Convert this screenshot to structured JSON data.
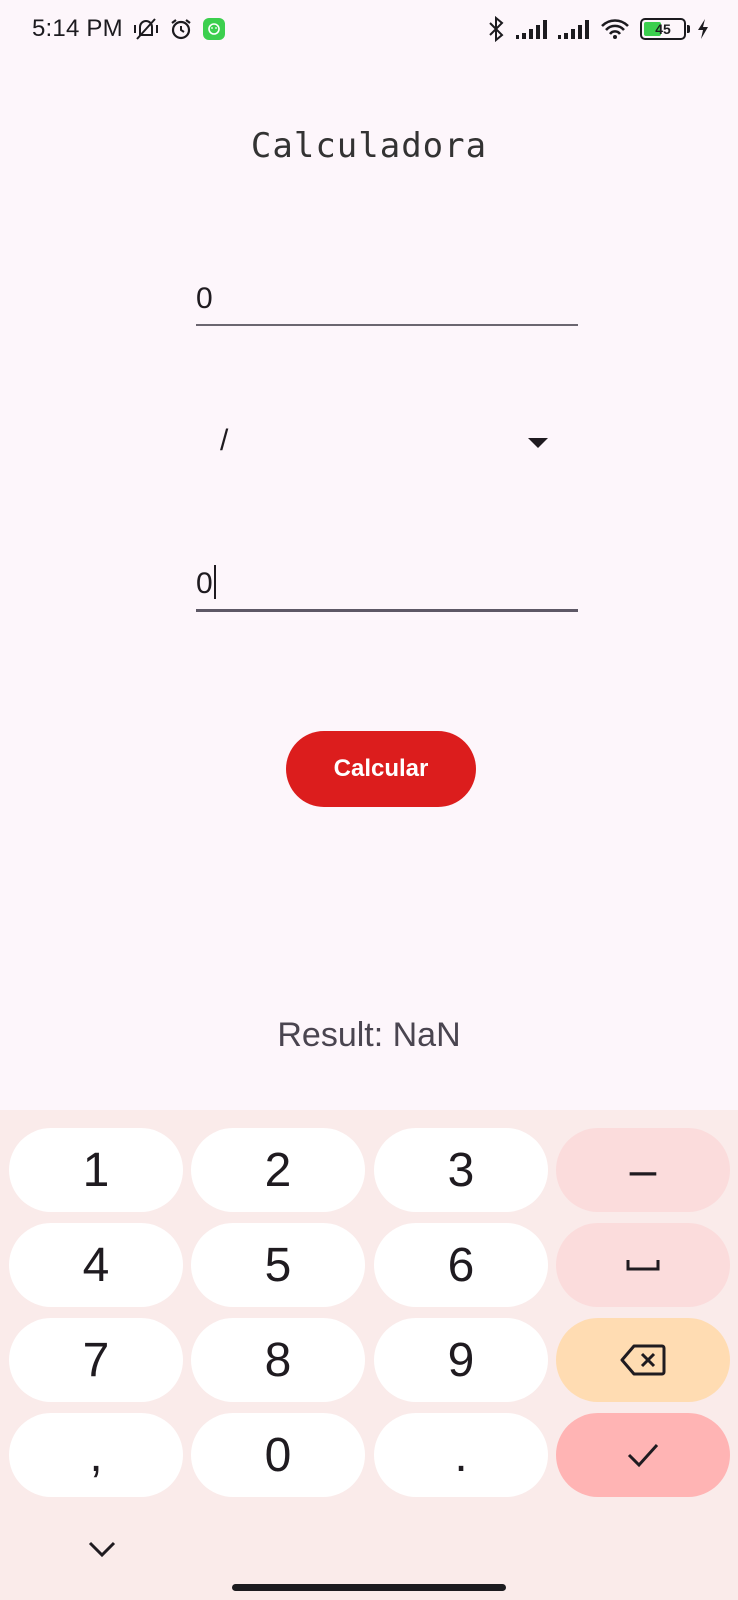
{
  "status_bar": {
    "time": "5:14 PM",
    "battery_level": "45",
    "icons": [
      "vibrate-off-icon",
      "alarm-icon",
      "app-notification-icon",
      "bluetooth-icon",
      "signal-icon",
      "signal-icon-2",
      "wifi-icon",
      "battery-icon",
      "charging-icon"
    ]
  },
  "app": {
    "title": "Calculadora",
    "first_number": "0",
    "operator": "/",
    "second_number": "0",
    "calculate_label": "Calcular",
    "result_text": "Result: NaN",
    "accent_color": "#dc1d1d",
    "background_color": "#fdf6fb"
  },
  "keyboard": {
    "keys": {
      "k1": "1",
      "k2": "2",
      "k3": "3",
      "minus": "–",
      "k4": "4",
      "k5": "5",
      "k6": "6",
      "k7": "7",
      "k8": "8",
      "k9": "9",
      "comma": ",",
      "k0": "0",
      "dot": "."
    },
    "icons": [
      "space-icon",
      "backspace-icon",
      "checkmark-icon",
      "chevron-down-icon"
    ],
    "colors": {
      "key": "#ffffff",
      "func": "#fbdcdc",
      "backspace": "#ffdcb2",
      "done": "#ffb4b4",
      "background": "#faebea"
    }
  }
}
